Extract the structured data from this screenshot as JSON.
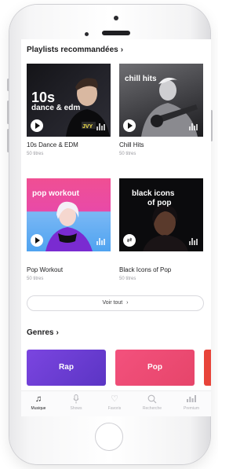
{
  "playlists_section": {
    "title": "Playlists recommandées",
    "chevron": "›"
  },
  "playlists": [
    {
      "art_text_line1": "10s",
      "art_text_line2": "dance & edm",
      "title": "10s Dance & EDM",
      "subtitle": "50 titres",
      "control_icon": "play-icon",
      "color": "#0f0f12"
    },
    {
      "art_text_line1": "chill hits",
      "title": "Chill Hits",
      "subtitle": "50 titres",
      "control_icon": "play-icon",
      "color": "#3a3a3c"
    },
    {
      "art_text_line1": "pop workout",
      "title": "Pop Workout",
      "subtitle": "50 titres",
      "control_icon": "play-icon",
      "color": "#e8488f"
    },
    {
      "art_text_line1": "black icons",
      "art_text_line2": "of pop",
      "title": "Black Icons of Pop",
      "subtitle": "50 titres",
      "control_icon": "shuffle-icon",
      "color": "#0a0a0c"
    }
  ],
  "see_all": {
    "label": "Voir tout",
    "chevron": "›"
  },
  "genres_section": {
    "title": "Genres",
    "chevron": "›"
  },
  "genres": [
    {
      "label": "Rap",
      "color": "#6a3fd0"
    },
    {
      "label": "Pop",
      "color": "#ec4a74"
    },
    {
      "label": "",
      "color": "#e8443a"
    }
  ],
  "tabbar": {
    "tabs": [
      {
        "label": "Musique",
        "icon": "music-note-icon",
        "active": true
      },
      {
        "label": "Shows",
        "icon": "microphone-icon",
        "active": false
      },
      {
        "label": "Favoris",
        "icon": "heart-icon",
        "active": false
      },
      {
        "label": "Recherche",
        "icon": "search-icon",
        "active": false
      },
      {
        "label": "Premium",
        "icon": "equalizer-icon",
        "active": false
      }
    ]
  }
}
